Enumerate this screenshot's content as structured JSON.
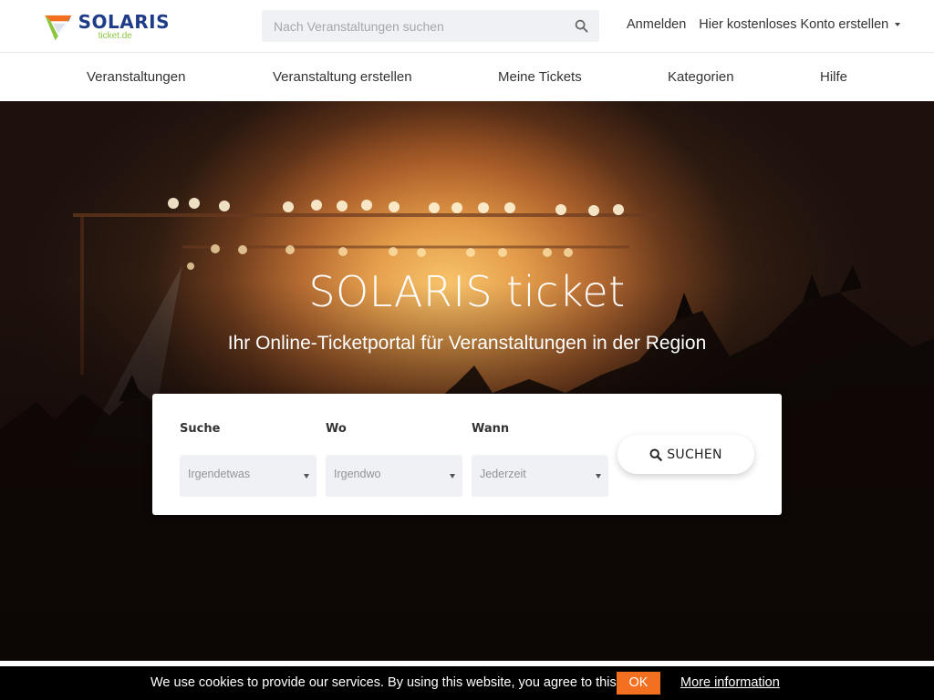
{
  "header": {
    "logo_title": "SOLARIS",
    "logo_subtitle": "ticket.de",
    "search_placeholder": "Nach Veranstaltungen suchen",
    "login_label": "Anmelden",
    "register_label": "Hier kostenloses Konto erstellen"
  },
  "nav": {
    "items": [
      {
        "label": "Veranstaltungen"
      },
      {
        "label": "Veranstaltung erstellen"
      },
      {
        "label": "Meine Tickets"
      },
      {
        "label": "Kategorien"
      },
      {
        "label": "Hilfe"
      }
    ]
  },
  "hero": {
    "title": "SOLARIS ticket",
    "subtitle": "Ihr Online-Ticketportal für Veranstaltungen in der Region"
  },
  "search_form": {
    "fields": [
      {
        "label": "Suche",
        "value": "Irgendetwas"
      },
      {
        "label": "Wo",
        "value": "Irgendwo"
      },
      {
        "label": "Wann",
        "value": "Jederzeit"
      }
    ],
    "button_label": "SUCHEN"
  },
  "cookie_bar": {
    "message": "We use cookies to provide our services. By using this website, you agree to this.",
    "ok_label": "OK",
    "more_label": "More information"
  },
  "colors": {
    "brand_blue": "#1f3c88",
    "brand_green": "#8cc63f",
    "cookie_accent": "#f37021"
  },
  "icons": {
    "search": "search-icon",
    "dropdown": "chevron-down-icon"
  }
}
